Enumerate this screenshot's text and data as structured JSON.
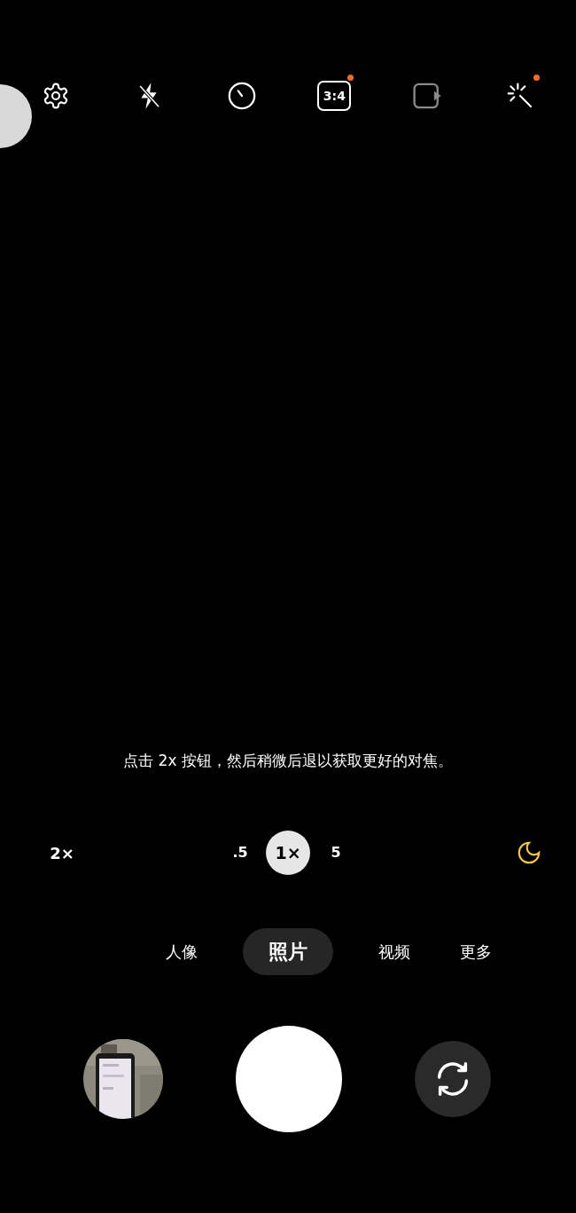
{
  "top_bar": [
    {
      "kind": "settings",
      "badge": false,
      "enabled": true
    },
    {
      "kind": "flash_off",
      "badge": false,
      "enabled": true
    },
    {
      "kind": "timer",
      "badge": false,
      "enabled": true
    },
    {
      "kind": "ratio",
      "label": "3:4",
      "badge": true,
      "enabled": true
    },
    {
      "kind": "motion_photo",
      "badge": false,
      "enabled": false
    },
    {
      "kind": "effects",
      "badge": true,
      "enabled": true
    }
  ],
  "hint": "点击 2x 按钮，然后稍微后退以获取更好的对焦。",
  "zoom": {
    "suggestion": "2×",
    "levels": [
      {
        "label": ".5",
        "selected": false
      },
      {
        "label": "1×",
        "selected": true
      },
      {
        "label": "5",
        "selected": false
      }
    ],
    "night_mode": {
      "on": true
    }
  },
  "modes": [
    {
      "label": "人像",
      "selected": false
    },
    {
      "label": "照片",
      "selected": true
    },
    {
      "label": "视频",
      "selected": false
    },
    {
      "label": "更多",
      "selected": false
    }
  ]
}
